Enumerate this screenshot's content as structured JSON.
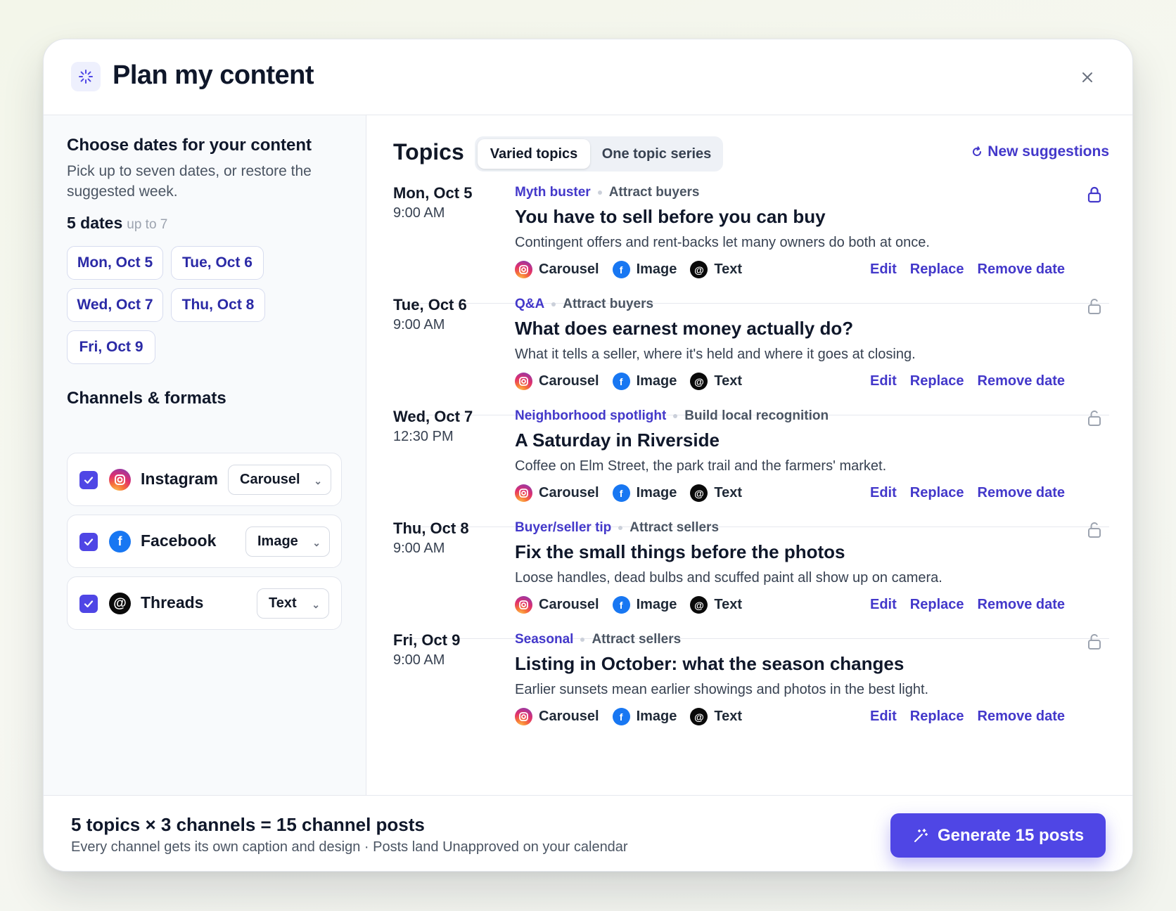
{
  "header": {
    "title": "Plan my content",
    "icon": "sparkle-icon",
    "close_icon": "close-icon"
  },
  "dates": {
    "heading": "Choose dates for your content",
    "description": "Pick up to seven dates, or restore the suggested week.",
    "count": "5 dates",
    "limit": "up to 7",
    "chips": [
      "Mon, Oct 5",
      "Tue, Oct 6",
      "Wed, Oct 7",
      "Thu, Oct 8",
      "Fri, Oct 9"
    ]
  },
  "channels": {
    "heading": "Channels & formats",
    "items": [
      {
        "name": "Instagram",
        "format": "Carousel",
        "checked": true,
        "icon": "instagram-icon"
      },
      {
        "name": "Facebook",
        "format": "Image",
        "checked": true,
        "icon": "facebook-icon"
      },
      {
        "name": "Threads",
        "format": "Text",
        "checked": true,
        "icon": "threads-icon"
      }
    ]
  },
  "topics": {
    "title": "Topics",
    "tabs": [
      "Varied topics",
      "One topic series"
    ],
    "active_tab": "Varied topics",
    "new_suggestions": "New suggestions",
    "formats": [
      "Carousel",
      "Image",
      "Text"
    ],
    "actions": [
      "Edit",
      "Replace",
      "Remove date"
    ],
    "items": [
      {
        "date": "Mon, Oct 5",
        "time": "9:00 AM",
        "category": "Myth buster",
        "goal": "Attract buyers",
        "title": "You have to sell before you can buy",
        "description": "Contingent offers and rent-backs let many owners do both at once.",
        "locked": true
      },
      {
        "date": "Tue, Oct 6",
        "time": "9:00 AM",
        "category": "Q&A",
        "goal": "Attract buyers",
        "title": "What does earnest money actually do?",
        "description": "What it tells a seller, where it's held and where it goes at closing.",
        "locked": false
      },
      {
        "date": "Wed, Oct 7",
        "time": "12:30 PM",
        "category": "Neighborhood spotlight",
        "goal": "Build local recognition",
        "title": "A Saturday in Riverside",
        "description": "Coffee on Elm Street, the park trail and the farmers' market.",
        "locked": false
      },
      {
        "date": "Thu, Oct 8",
        "time": "9:00 AM",
        "category": "Buyer/seller tip",
        "goal": "Attract sellers",
        "title": "Fix the small things before the photos",
        "description": "Loose handles, dead bulbs and scuffed paint all show up on camera.",
        "locked": false
      },
      {
        "date": "Fri, Oct 9",
        "time": "9:00 AM",
        "category": "Seasonal",
        "goal": "Attract sellers",
        "title": "Listing in October: what the season changes",
        "description": "Earlier sunsets mean earlier showings and photos in the best light.",
        "locked": false
      }
    ]
  },
  "footer": {
    "summary": "5 topics × 3 channels = 15 channel posts",
    "note": "Every channel gets its own caption and design · Posts land Unapproved on your calendar",
    "generate_label": "Generate 15 posts"
  },
  "colors": {
    "accent": "#4f46e5",
    "accent_text": "#4338ca",
    "facebook": "#1877f2",
    "threads": "#0a0a0a"
  }
}
